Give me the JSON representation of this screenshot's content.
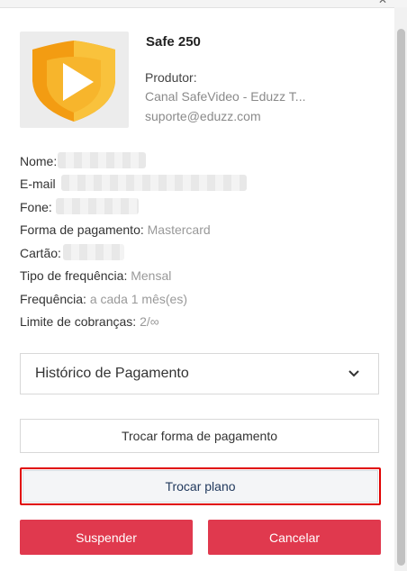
{
  "product": {
    "name": "Safe 250",
    "producer_label": "Produtor:",
    "producer_name": "Canal SafeVideo - Eduzz T...",
    "producer_email": "suporte@eduzz.com",
    "image_icon": "play-shield-logo-icon"
  },
  "details": {
    "name_label": "Nome:",
    "email_label": "E-mail",
    "phone_label": "Fone:",
    "payment_method_label": "Forma de pagamento:",
    "payment_method_value": "Mastercard",
    "card_label": "Cartão:",
    "frequency_type_label": "Tipo de frequência:",
    "frequency_type_value": "Mensal",
    "frequency_label": "Frequência:",
    "frequency_value": "a cada 1 mês(es)",
    "charge_limit_label": "Limite de cobranças:",
    "charge_limit_value": "2/∞"
  },
  "payment_history": {
    "label": "Histórico de Pagamento",
    "icon": "chevron-down-icon"
  },
  "actions": {
    "change_payment_label": "Trocar forma de pagamento",
    "change_plan_label": "Trocar plano",
    "suspend_label": "Suspender",
    "cancel_label": "Cancelar"
  },
  "colors": {
    "danger": "#e0394e",
    "highlight_border": "#e00000",
    "logo_orange": "#f39c12",
    "logo_yellow": "#f9c23c"
  }
}
